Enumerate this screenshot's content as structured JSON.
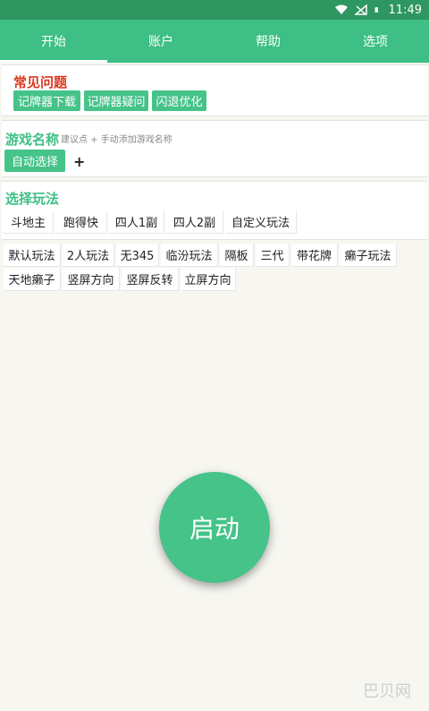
{
  "status": {
    "time": "11:49"
  },
  "tabs": [
    {
      "label": "开始"
    },
    {
      "label": "账户"
    },
    {
      "label": "帮助"
    },
    {
      "label": "选项"
    }
  ],
  "faq": {
    "title": "常见问题",
    "buttons": [
      "记牌器下载",
      "记牌器疑问",
      "闪退优化"
    ]
  },
  "game_name": {
    "title": "游戏名称",
    "hint": "建议点 + 手动添加游戏名称",
    "auto_select": "自动选择",
    "add": "+"
  },
  "play_mode": {
    "title": "选择玩法",
    "options": [
      "斗地主",
      "跑得快",
      "四人1副",
      "四人2副",
      "自定义玩法"
    ]
  },
  "variants": {
    "row1": [
      "默认玩法",
      "2人玩法",
      "无345",
      "临汾玩法",
      "隔板",
      "三代",
      "带花牌",
      "癞子玩法"
    ],
    "row2": [
      "天地癞子",
      "竖屏方向",
      "竖屏反转",
      "立屏方向"
    ]
  },
  "start_label": "启动",
  "watermark": "巴贝网",
  "colors": {
    "primary": "#3dbf85",
    "status": "#2e9660",
    "faq_title": "#d9371f"
  }
}
